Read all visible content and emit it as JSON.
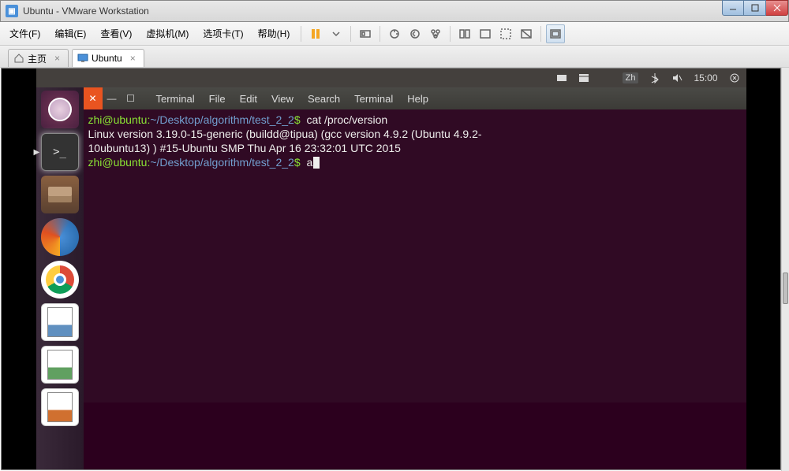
{
  "titlebar": {
    "title": "Ubuntu - VMware Workstation"
  },
  "vm_menu": {
    "items": [
      "文件(F)",
      "编辑(E)",
      "查看(V)",
      "虚拟机(M)",
      "选项卡(T)",
      "帮助(H)"
    ]
  },
  "vm_tabs": {
    "home": "主页",
    "ubuntu": "Ubuntu"
  },
  "ubuntu_topbar": {
    "ime": "Zh",
    "time": "15:00"
  },
  "terminal": {
    "menu": [
      "Terminal",
      "File",
      "Edit",
      "View",
      "Search",
      "Terminal",
      "Help"
    ],
    "prompt_user": "zhi@ubuntu",
    "prompt_path": "~/Desktop/algorithm/test_2_2",
    "cmd1": "cat /proc/version",
    "output_line1": "Linux version 3.19.0-15-generic (buildd@tipua) (gcc version 4.9.2 (Ubuntu 4.9.2-",
    "output_line2": "10ubuntu13) ) #15-Ubuntu SMP Thu Apr 16 23:32:01 UTC 2015",
    "cmd2": "a"
  }
}
